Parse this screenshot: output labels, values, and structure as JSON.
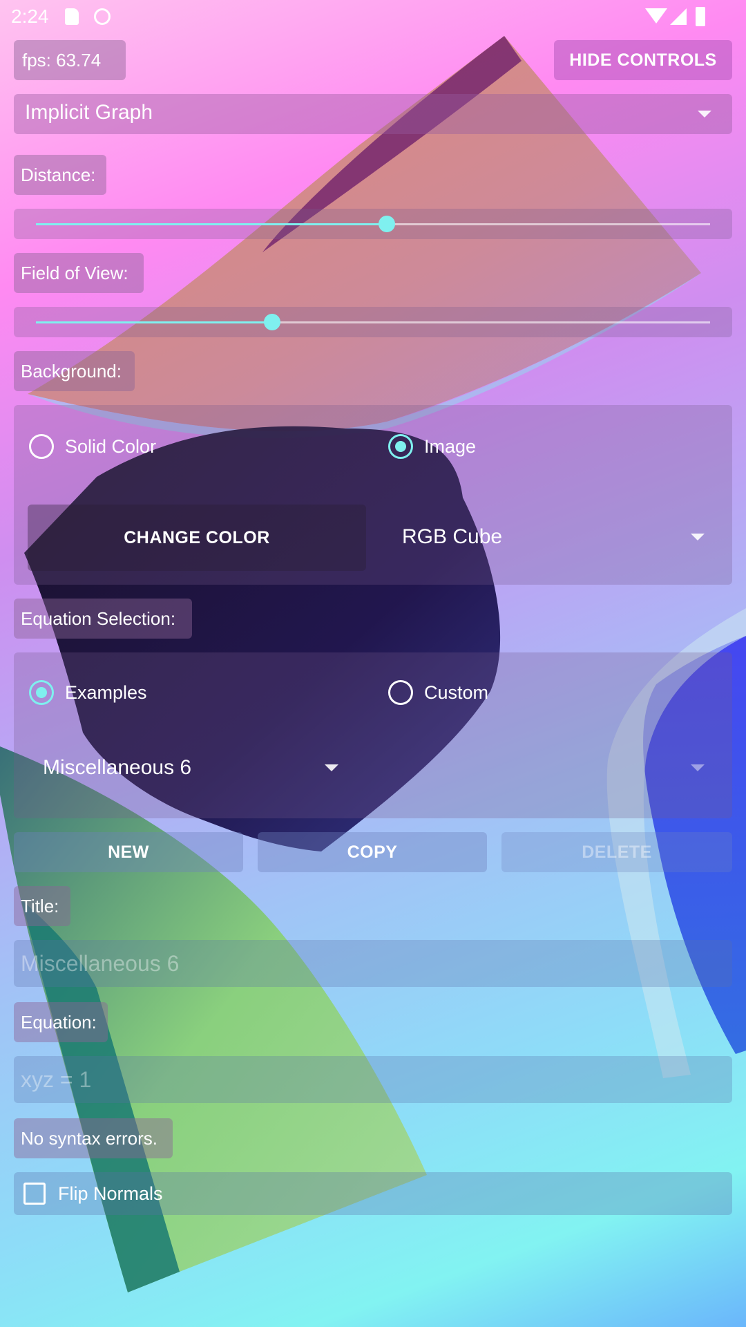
{
  "status_bar": {
    "time": "2:24"
  },
  "fps": "fps: 63.74",
  "hide_controls": "HIDE CONTROLS",
  "mode": {
    "selected": "Implicit Graph"
  },
  "distance": {
    "label": "Distance:",
    "value_fraction": 0.52
  },
  "fov": {
    "label": "Field of View:",
    "value_fraction": 0.35
  },
  "background": {
    "label": "Background:",
    "solid_color_label": "Solid Color",
    "image_label": "Image",
    "selected": "Image",
    "change_color": "CHANGE COLOR",
    "image_selected": "RGB Cube"
  },
  "equation_selection": {
    "label": "Equation Selection:",
    "examples_label": "Examples",
    "custom_label": "Custom",
    "selected": "Examples",
    "example_selected": "Miscellaneous 6"
  },
  "actions": {
    "new": "NEW",
    "copy": "COPY",
    "delete": "DELETE"
  },
  "title": {
    "label": "Title:",
    "value": "Miscellaneous 6"
  },
  "equation": {
    "label": "Equation:",
    "value": "xyz = 1"
  },
  "syntax_status": "No syntax errors.",
  "flip_normals": {
    "label": "Flip Normals",
    "checked": false
  },
  "colors": {
    "accent": "#7ff0ef"
  }
}
